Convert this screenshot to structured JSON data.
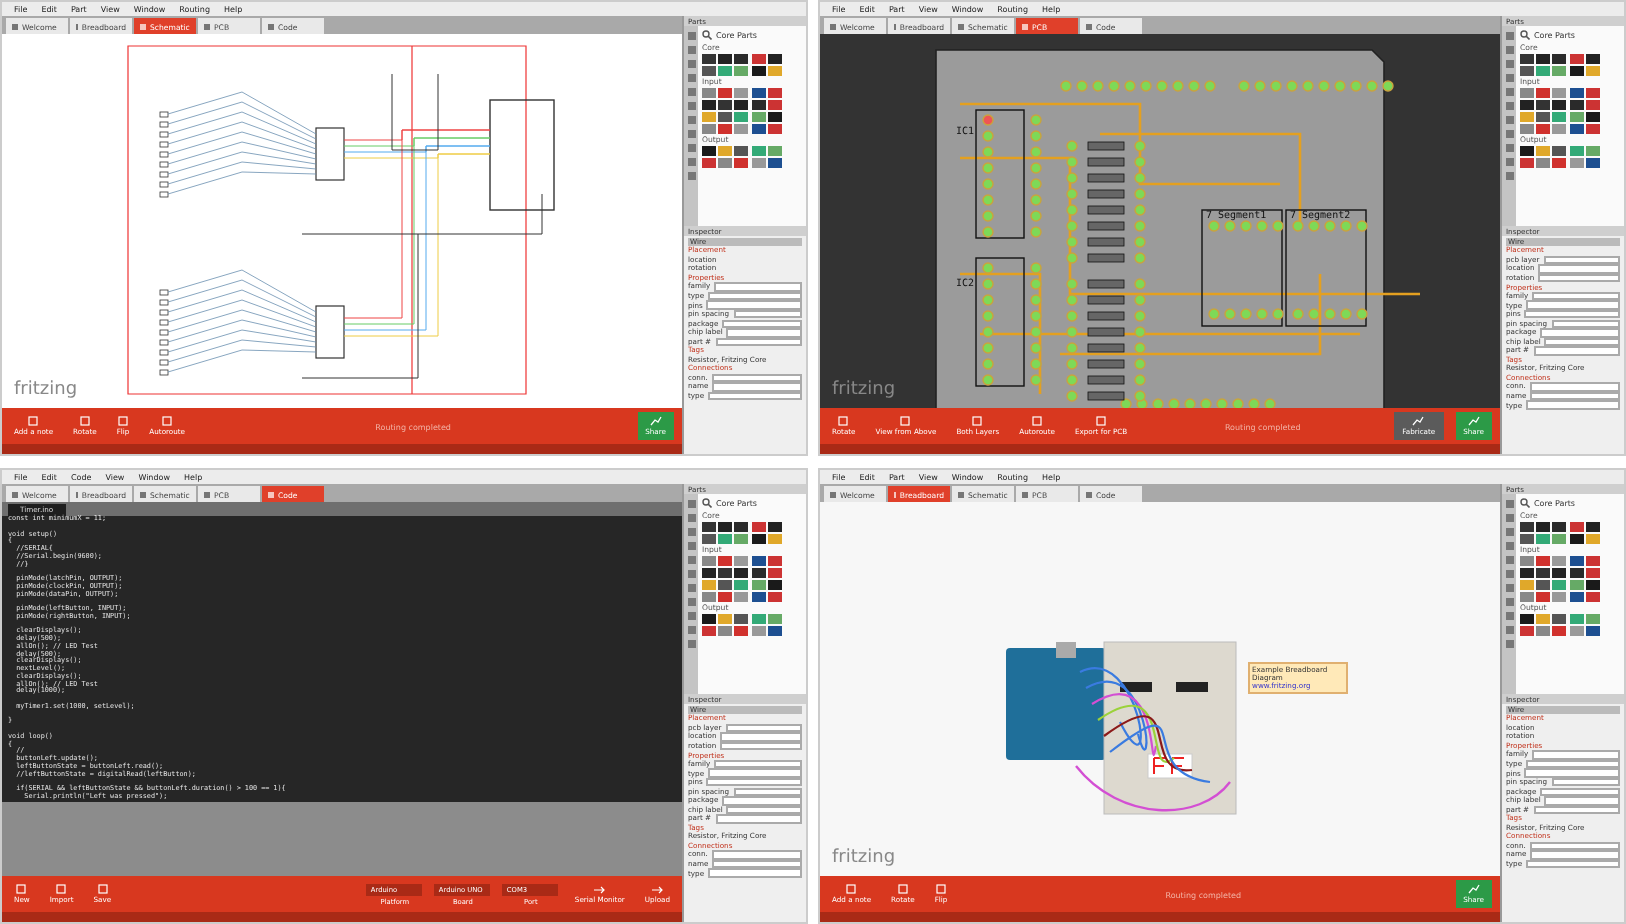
{
  "windows": [
    {
      "kind": "schematic",
      "menu": [
        "File",
        "Edit",
        "Part",
        "View",
        "Window",
        "Routing",
        "Help"
      ],
      "tabs": [
        {
          "label": "Welcome",
          "selected": false
        },
        {
          "label": "Breadboard",
          "selected": false
        },
        {
          "label": "Schematic",
          "selected": true
        },
        {
          "label": "PCB",
          "selected": false
        },
        {
          "label": "Code",
          "selected": false
        }
      ],
      "logo": "fritzing",
      "toolbar": [
        {
          "kind": "button",
          "label": "Add a note"
        },
        {
          "kind": "button",
          "label": "Rotate"
        },
        {
          "kind": "button",
          "label": "Flip"
        },
        {
          "kind": "button",
          "label": "Autoroute"
        }
      ],
      "status": "Routing completed",
      "right_buttons": [
        {
          "kind": "primary",
          "label": "Share"
        }
      ],
      "parts": {
        "title": "Parts",
        "bin": "Core Parts",
        "sections": [
          "Core",
          "Input",
          "Output"
        ]
      },
      "inspector": {
        "title": "Inspector",
        "part": "Wire",
        "sections": [
          {
            "heading": "Placement",
            "rows": [
              "location",
              "rotation"
            ]
          },
          {
            "heading": "Properties",
            "rows": [
              "family",
              "type",
              "pins",
              "pin spacing",
              "package",
              "chip label",
              "part #"
            ]
          },
          {
            "heading": "Tags",
            "rows": [
              "Resistor, Fritzing Core"
            ]
          },
          {
            "heading": "Connections",
            "rows": [
              "conn.",
              "name",
              "type"
            ]
          }
        ]
      }
    },
    {
      "kind": "pcb",
      "menu": [
        "File",
        "Edit",
        "Part",
        "View",
        "Window",
        "Routing",
        "Help"
      ],
      "tabs": [
        {
          "label": "Welcome",
          "selected": false
        },
        {
          "label": "Breadboard",
          "selected": false
        },
        {
          "label": "Schematic",
          "selected": false
        },
        {
          "label": "PCB",
          "selected": true
        },
        {
          "label": "Code",
          "selected": false
        }
      ],
      "canvas_labels": [
        "IC1",
        "IC2",
        "7 Segment1",
        "7 Segment2"
      ],
      "logo": "fritzing",
      "toolbar": [
        {
          "kind": "button",
          "label": "Rotate"
        },
        {
          "kind": "button",
          "label": "View from Above"
        },
        {
          "kind": "button",
          "label": "Both Layers"
        },
        {
          "kind": "button",
          "label": "Autoroute"
        },
        {
          "kind": "button",
          "label": "Export for PCB"
        }
      ],
      "status": "Routing completed",
      "right_buttons": [
        {
          "kind": "secondary",
          "label": "Fabricate"
        },
        {
          "kind": "primary",
          "label": "Share"
        }
      ],
      "parts": {
        "title": "Parts",
        "bin": "Core Parts",
        "sections": [
          "Core",
          "Input",
          "Output"
        ]
      },
      "inspector": {
        "title": "Inspector",
        "part": "Wire",
        "sections": [
          {
            "heading": "Placement",
            "rows": [
              "pcb layer",
              "location",
              "rotation"
            ]
          },
          {
            "heading": "Properties",
            "rows": [
              "family",
              "type",
              "pins",
              "pin spacing",
              "package",
              "chip label",
              "part #"
            ]
          },
          {
            "heading": "Tags",
            "rows": [
              "Resistor, Fritzing Core"
            ]
          },
          {
            "heading": "Connections",
            "rows": [
              "conn.",
              "name",
              "type"
            ]
          }
        ]
      }
    },
    {
      "kind": "code",
      "menu": [
        "File",
        "Edit",
        "Code",
        "View",
        "Window",
        "Help"
      ],
      "tabs": [
        {
          "label": "Welcome",
          "selected": false
        },
        {
          "label": "Breadboard",
          "selected": false
        },
        {
          "label": "Schematic",
          "selected": false
        },
        {
          "label": "PCB",
          "selected": false
        },
        {
          "label": "Code",
          "selected": true
        }
      ],
      "file_tab": "Timer.ino",
      "code": [
        {
          "text": "const int minimumX = 11;",
          "gap_before": false
        },
        {
          "text": "void setup()",
          "gap_before": true
        },
        {
          "text": "{",
          "gap_before": false
        },
        {
          "text": "  //SERIAL{",
          "gap_before": false
        },
        {
          "text": "  //Serial.begin(9600);",
          "gap_before": false
        },
        {
          "text": "  //}",
          "gap_before": false
        },
        {
          "text": "  pinMode(latchPin, OUTPUT);",
          "gap_before": true
        },
        {
          "text": "  pinMode(clockPin, OUTPUT);",
          "gap_before": false
        },
        {
          "text": "  pinMode(dataPin, OUTPUT);",
          "gap_before": false
        },
        {
          "text": "  pinMode(leftButton, INPUT);",
          "gap_before": true
        },
        {
          "text": "  pinMode(rightButton, INPUT);",
          "gap_before": false
        },
        {
          "text": "  clearDisplays();",
          "gap_before": true
        },
        {
          "text": "  delay(500);",
          "gap_before": false
        },
        {
          "text": "  allOn(); // LED Test",
          "gap_before": false
        },
        {
          "text": "  delay(500);",
          "gap_before": false
        },
        {
          "text": "  clearDisplays();",
          "gap_before": false
        },
        {
          "text": "  nextLevel();",
          "gap_before": false
        },
        {
          "text": "  clearDisplays();",
          "gap_before": false
        },
        {
          "text": "  allOn(); // LED Test",
          "gap_before": false
        },
        {
          "text": "  delay(1000);",
          "gap_before": false
        },
        {
          "text": "  myTimer1.set(1000, setLevel);",
          "gap_before": true
        },
        {
          "text": "}",
          "gap_before": true
        },
        {
          "text": "void loop()",
          "gap_before": true
        },
        {
          "text": "{",
          "gap_before": false
        },
        {
          "text": "  //",
          "gap_before": false
        },
        {
          "text": "  buttonLeft.update();",
          "gap_before": false
        },
        {
          "text": "  leftButtonState = buttonLeft.read();",
          "gap_before": false
        },
        {
          "text": "  //leftButtonState = digitalRead(leftButton);",
          "gap_before": false
        },
        {
          "text": "  if(SERIAL && leftButtonState && buttonLeft.duration() > 100 == 1){",
          "gap_before": true
        },
        {
          "text": "    Serial.println(\"Left was pressed\");",
          "gap_before": false
        }
      ],
      "toolbar": [
        {
          "kind": "button",
          "label": "New"
        },
        {
          "kind": "button",
          "label": "Import"
        },
        {
          "kind": "button",
          "label": "Save"
        }
      ],
      "controls": [
        {
          "kind": "dropdown",
          "value": "Arduino",
          "caption": "Platform"
        },
        {
          "kind": "dropdown",
          "value": "Arduino UNO",
          "caption": "Board"
        },
        {
          "kind": "dropdown",
          "value": "COM3",
          "caption": "Port"
        },
        {
          "kind": "button",
          "caption": "Serial Monitor"
        },
        {
          "kind": "button",
          "caption": "Upload"
        }
      ],
      "parts": {
        "title": "Parts",
        "bin": "Core Parts",
        "sections": [
          "Core",
          "Input",
          "Output"
        ]
      },
      "inspector": {
        "title": "Inspector",
        "part": "Wire",
        "sections": [
          {
            "heading": "Placement",
            "rows": [
              "pcb layer",
              "location",
              "rotation"
            ]
          },
          {
            "heading": "Properties",
            "rows": [
              "family",
              "type",
              "pins",
              "pin spacing",
              "package",
              "chip label",
              "part #"
            ]
          },
          {
            "heading": "Tags",
            "rows": [
              "Resistor, Fritzing Core"
            ]
          },
          {
            "heading": "Connections",
            "rows": [
              "conn.",
              "name",
              "type"
            ]
          }
        ]
      }
    },
    {
      "kind": "breadboard",
      "menu": [
        "File",
        "Edit",
        "Part",
        "View",
        "Window",
        "Routing",
        "Help"
      ],
      "tabs": [
        {
          "label": "Welcome",
          "selected": false
        },
        {
          "label": "Breadboard",
          "selected": true
        },
        {
          "label": "Schematic",
          "selected": false
        },
        {
          "label": "PCB",
          "selected": false
        },
        {
          "label": "Code",
          "selected": false
        }
      ],
      "note": [
        "Example Breadboard",
        "Diagram",
        "www.fritzing.org"
      ],
      "logo": "fritzing",
      "toolbar": [
        {
          "kind": "button",
          "label": "Add a note"
        },
        {
          "kind": "button",
          "label": "Rotate"
        },
        {
          "kind": "button",
          "label": "Flip"
        }
      ],
      "status": "Routing completed",
      "right_buttons": [
        {
          "kind": "primary",
          "label": "Share"
        }
      ],
      "parts": {
        "title": "Parts",
        "bin": "Core Parts",
        "sections": [
          "Core",
          "Input",
          "Output"
        ]
      },
      "inspector": {
        "title": "Inspector",
        "part": "Wire",
        "sections": [
          {
            "heading": "Placement",
            "rows": [
              "location",
              "rotation"
            ]
          },
          {
            "heading": "Properties",
            "rows": [
              "family",
              "type",
              "pins",
              "pin spacing",
              "package",
              "chip label",
              "part #"
            ]
          },
          {
            "heading": "Tags",
            "rows": [
              "Resistor, Fritzing Core"
            ]
          },
          {
            "heading": "Connections",
            "rows": [
              "conn.",
              "name",
              "type"
            ]
          }
        ]
      }
    }
  ]
}
